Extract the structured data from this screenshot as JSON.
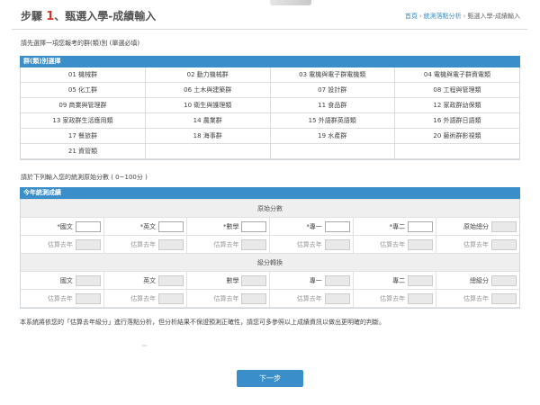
{
  "header": {
    "step_label": "步驟",
    "step_number": "1",
    "title": "、甄選入學-成績輸入",
    "breadcrumb": [
      "首頁",
      "統測落點分析",
      "甄選入學-成績輸入"
    ]
  },
  "group_hint": "請先選擇一項您報考的群(類)別 (單選必填)",
  "groups_panel": {
    "title": "群(類)別選擇",
    "groups": [
      "01 機械群",
      "02 動力機械群",
      "03 電機與電子群電機類",
      "04 電機與電子群資電類",
      "05 化工群",
      "06 土木與建築群",
      "07 設計群",
      "08 工程與管理類",
      "09 商業與管理群",
      "10 衛生與護理類",
      "11 食品群",
      "12 家政群幼保類",
      "13 家政群生活應用類",
      "14 農業群",
      "15 外語群英語類",
      "16 外語群日語類",
      "17 餐旅群",
      "18 海事群",
      "19 水產群",
      "20 藝術群影視類",
      "21 資管類"
    ]
  },
  "score_hint": "請於下列輸入您的統測原始分數 ( 0~100分 )",
  "scores_panel": {
    "title": "今年統測成績",
    "raw_heading": "原始分數",
    "raw_subjects": [
      "*國文",
      "*英文",
      "*數學",
      "*專一",
      "*專二"
    ],
    "raw_total_label": "原始總分",
    "estimate_label": "估算去年",
    "level_heading": "級分轉換",
    "level_subjects": [
      "國文",
      "英文",
      "數學",
      "專一",
      "專二"
    ],
    "level_total_label": "總級分"
  },
  "note": "本系統將依您的「估算去年級分」進行落點分析，但分析結果不保證預測正確性，請您可多參照以上成績資訊以做出更明確的判斷。",
  "next_button": "下一步",
  "colors": {
    "accent": "#3a8ec9",
    "step_number": "#d9342b"
  }
}
